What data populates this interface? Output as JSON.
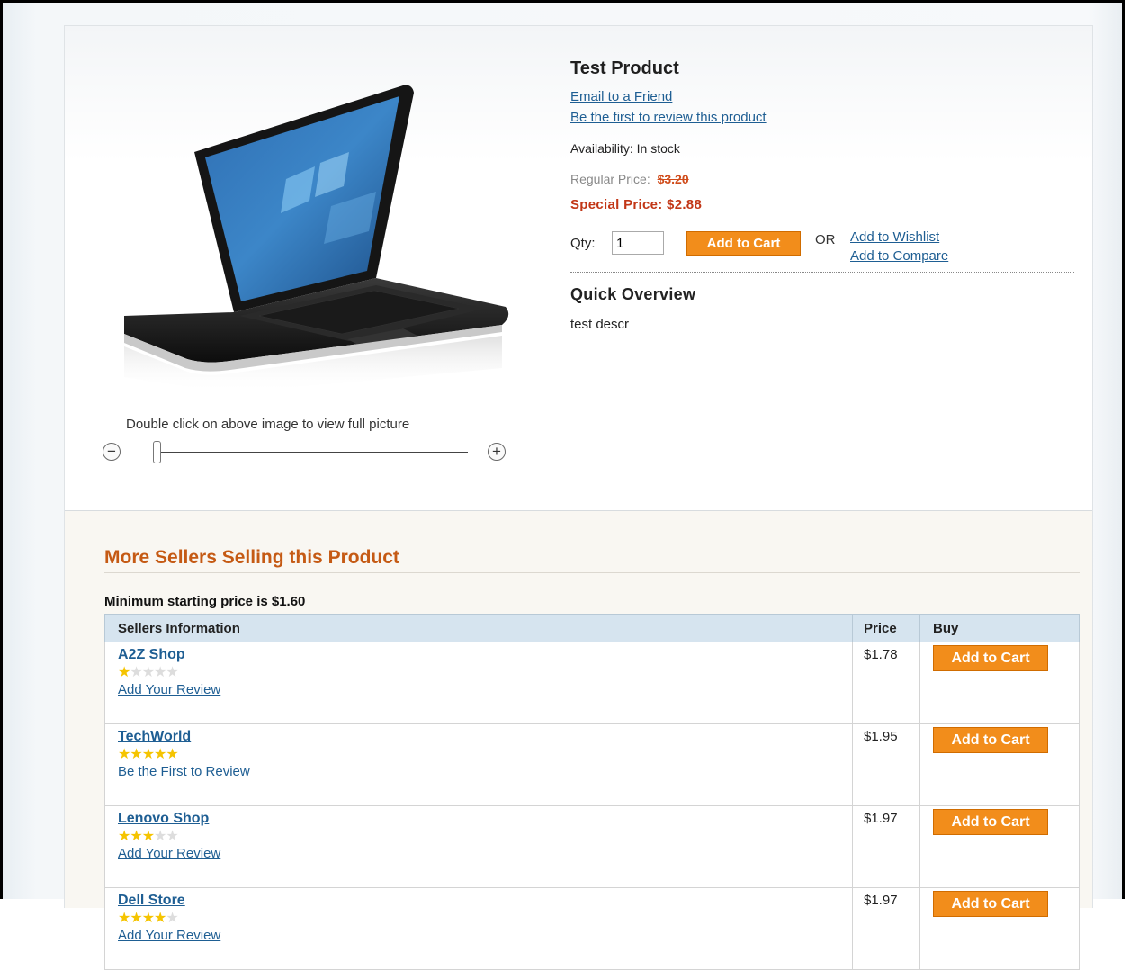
{
  "product": {
    "title": "Test Product",
    "email_link": "Email to a Friend",
    "review_link": "Be the first to review this product",
    "availability": "Availability: In stock",
    "regular_price_label": "Regular Price:",
    "regular_price_value": "$3.20",
    "special_price": "Special Price: $2.88",
    "qty_label": "Qty:",
    "qty_value": "1",
    "add_to_cart": "Add to Cart",
    "or_text": "OR",
    "wishlist_link": "Add to Wishlist",
    "compare_link": "Add to Compare",
    "overview_title": "Quick Overview",
    "overview_text": "test descr",
    "image_hint": "Double click on above image to view full picture",
    "zoom_out_symbol": "−",
    "zoom_in_symbol": "+"
  },
  "sellers": {
    "title": "More Sellers Selling this Product",
    "min_price": "Minimum starting price is $1.60",
    "headers": {
      "info": "Sellers Information",
      "price": "Price",
      "buy": "Buy"
    },
    "rows": [
      {
        "name": "A2Z Shop",
        "rating": 1,
        "review_link": "Add Your Review",
        "price": "$1.78",
        "button": "Add to Cart"
      },
      {
        "name": "TechWorld",
        "rating": 5,
        "review_link": "Be the First to Review",
        "price": "$1.95",
        "button": "Add to Cart"
      },
      {
        "name": "Lenovo Shop",
        "rating": 3,
        "review_link": "Add Your Review",
        "price": "$1.97",
        "button": "Add to Cart"
      },
      {
        "name": "Dell Store",
        "rating": 4,
        "review_link": "Add Your Review",
        "price": "$1.97",
        "button": "Add to Cart"
      }
    ]
  },
  "colors": {
    "accent_orange": "#f28d1b",
    "link_blue": "#1e5e93",
    "special_price_red": "#c23616",
    "section_title_orange": "#c55a14",
    "star_yellow": "#f5c400"
  }
}
